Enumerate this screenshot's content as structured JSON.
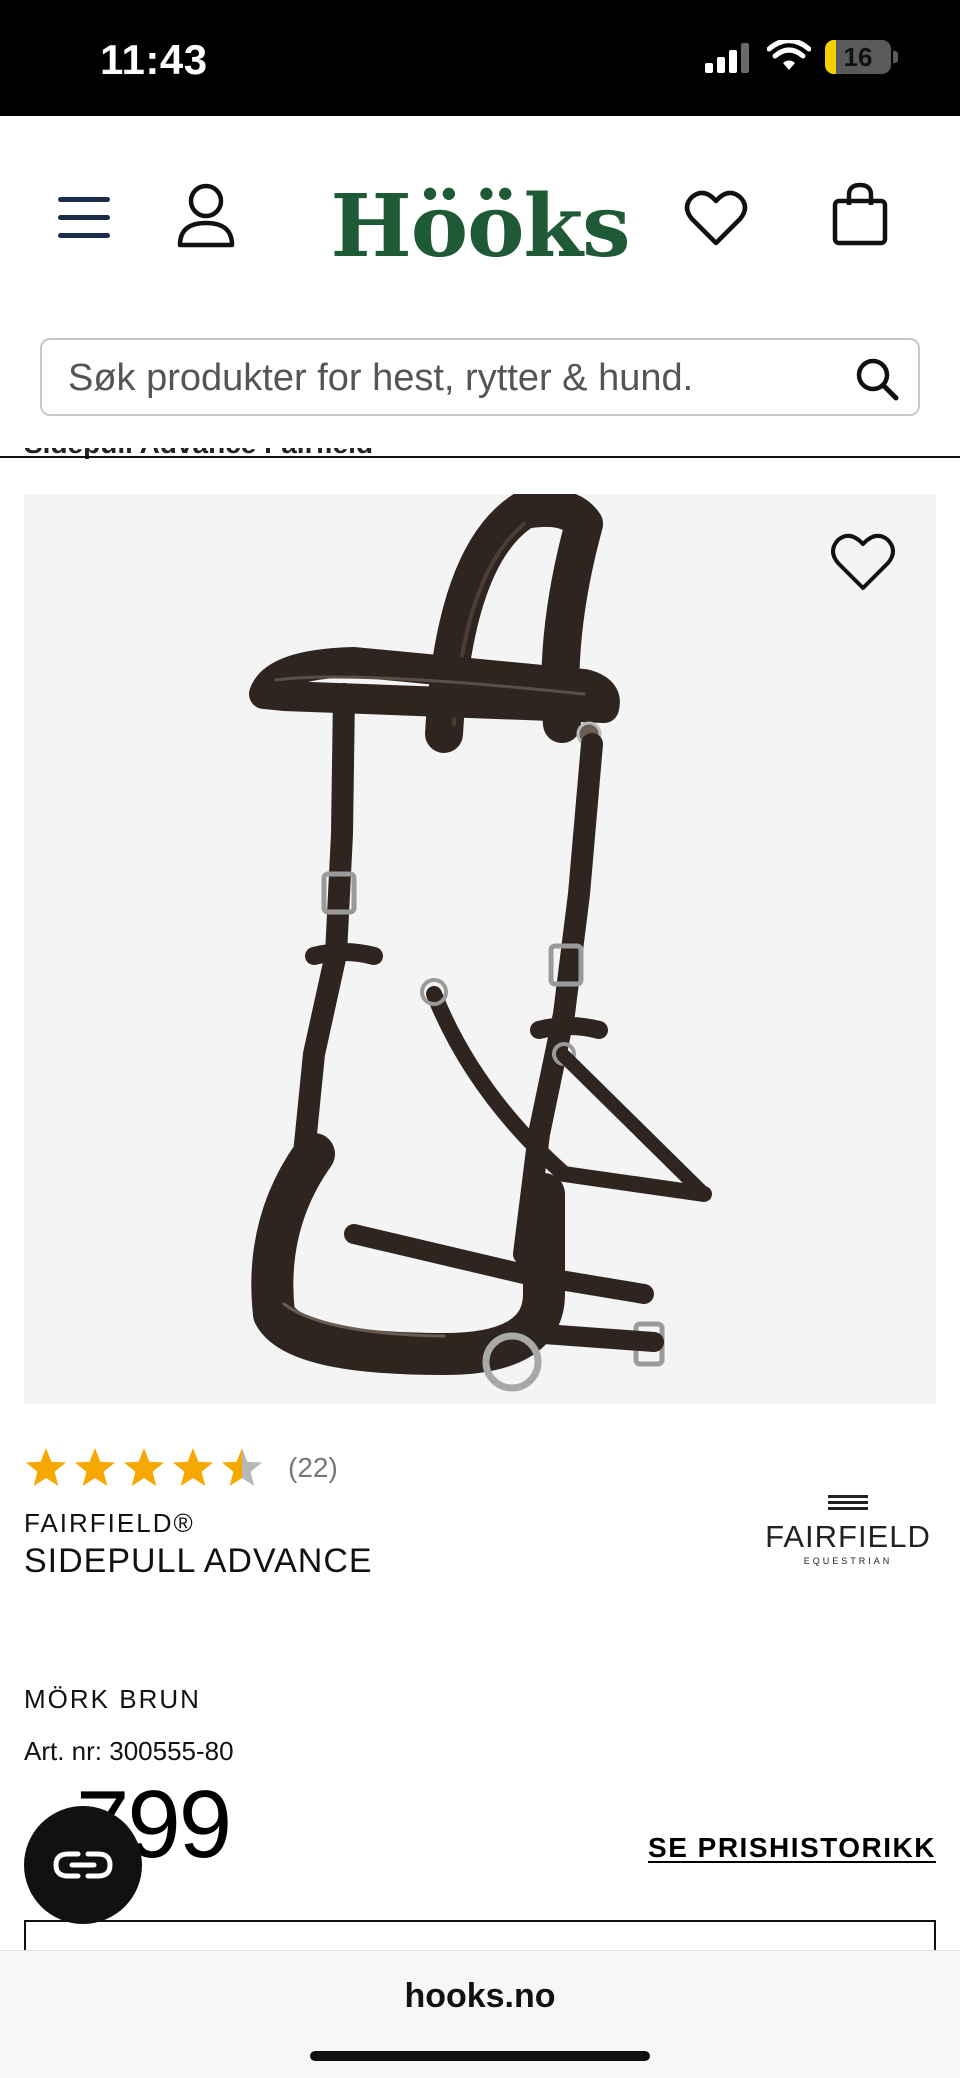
{
  "status_bar": {
    "time": "11:43",
    "battery": "16",
    "battery_level": 0.16
  },
  "header": {
    "logo": "Hööks",
    "icons": [
      "menu-icon",
      "account-icon",
      "wishlist-icon",
      "cart-icon"
    ]
  },
  "search": {
    "placeholder": "Søk produkter for hest, rytter & hund."
  },
  "breadcrumb": {
    "text": "Sidepull Advance Fairfield"
  },
  "product": {
    "rating_value": 4.5,
    "rating_max": 5,
    "review_count": "(22)",
    "brand": "FAIRFIELD®",
    "name": "SIDEPULL ADVANCE",
    "brand_logo_name": "FAIRFIELD",
    "brand_logo_sub": "EQUESTRIAN",
    "color": "MÖRK BRUN",
    "article_number": "Art. nr: 300555-80",
    "price": "799",
    "price_history": "SE PRISHISTORIKK"
  },
  "browser": {
    "url": "hooks.no"
  },
  "colors": {
    "brand_green": "#1f5a36",
    "star": "#f5a800",
    "star_empty": "#b7b7b7",
    "leather": "#2e2520"
  }
}
